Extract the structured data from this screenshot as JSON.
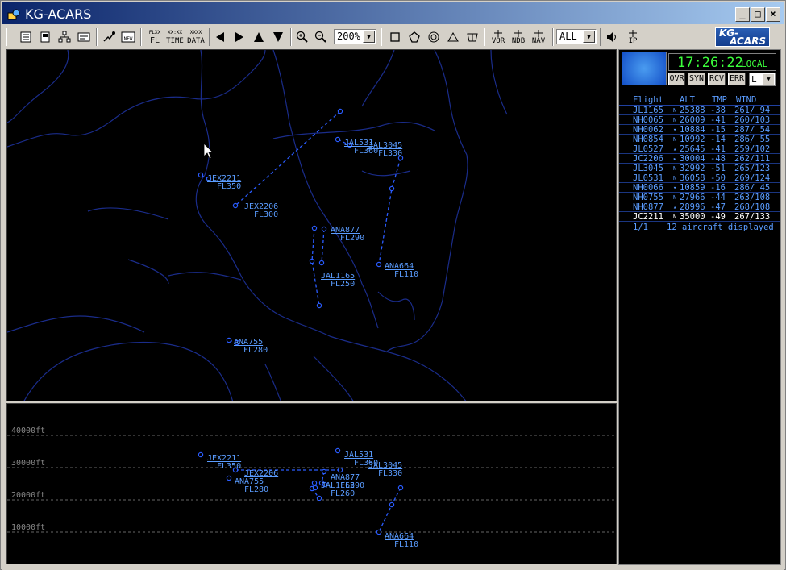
{
  "window": {
    "title": "KG-ACARS"
  },
  "titlebar": {
    "minimize": "_",
    "maximize": "□",
    "close": "×"
  },
  "toolbar": {
    "fl_label": "FL",
    "time_label": "TIME",
    "data_label": "DATA",
    "vor_label": "VOR",
    "ndb_label": "NDB",
    "nav_label": "NAV",
    "ip_label": "IP",
    "zoom_value": "200%",
    "filter_value": "ALL",
    "logo_line1": "KG-",
    "logo_line2": "ACARS"
  },
  "clock": {
    "time": "17:26:22",
    "zone": "LOCAL"
  },
  "flags": [
    "OVR",
    "SYN",
    "RCV",
    "ERR"
  ],
  "level_select": "L",
  "flight_list": {
    "headers": [
      "Flight",
      "ALT",
      "TMP",
      "WIND"
    ],
    "rows": [
      {
        "flight": "JL1165",
        "trend": "N",
        "alt": "25388",
        "tmp": "-38",
        "wind": "261/ 94",
        "selected": false
      },
      {
        "flight": "NH0065",
        "trend": "N",
        "alt": "26009",
        "tmp": "-41",
        "wind": "260/103",
        "selected": false
      },
      {
        "flight": "NH0062",
        "trend": "▾",
        "alt": "10884",
        "tmp": "-15",
        "wind": "287/ 54",
        "selected": false
      },
      {
        "flight": "NH0854",
        "trend": "N",
        "alt": "10992",
        "tmp": "-14",
        "wind": "286/ 55",
        "selected": false
      },
      {
        "flight": "JL0527",
        "trend": "▴",
        "alt": "25645",
        "tmp": "-41",
        "wind": "259/102",
        "selected": false
      },
      {
        "flight": "JC2206",
        "trend": "▸",
        "alt": "30004",
        "tmp": "-48",
        "wind": "262/111",
        "selected": false
      },
      {
        "flight": "JL3045",
        "trend": "N",
        "alt": "32992",
        "tmp": "-51",
        "wind": "265/123",
        "selected": false
      },
      {
        "flight": "JL0531",
        "trend": "N",
        "alt": "36058",
        "tmp": "-50",
        "wind": "269/124",
        "selected": false
      },
      {
        "flight": "NH0066",
        "trend": "▾",
        "alt": "10859",
        "tmp": "-16",
        "wind": "286/ 45",
        "selected": false
      },
      {
        "flight": "NH0755",
        "trend": "N",
        "alt": "27966",
        "tmp": "-44",
        "wind": "263/108",
        "selected": false
      },
      {
        "flight": "NH0877",
        "trend": "▴",
        "alt": "28996",
        "tmp": "-47",
        "wind": "268/108",
        "selected": false
      },
      {
        "flight": "JC2211",
        "trend": "N",
        "alt": "35000",
        "tmp": "-49",
        "wind": "267/133",
        "selected": true
      }
    ],
    "footer_page": "1/1",
    "footer_text": "12 aircraft displayed"
  },
  "map_labels": [
    {
      "callsign": "JEX2211",
      "level": "FL350"
    },
    {
      "callsign": "JEX2206",
      "level": "FL300"
    },
    {
      "callsign": "JAL531",
      "level": "FL360"
    },
    {
      "callsign": "JAL3045",
      "level": "FL330"
    },
    {
      "callsign": "ANA877",
      "level": "FL290"
    },
    {
      "callsign": "JAL1165",
      "level": "FL250"
    },
    {
      "callsign": "ANA664",
      "level": "FL110"
    },
    {
      "callsign": "ANA755",
      "level": "FL280"
    }
  ],
  "profile_axis": [
    "40000ft",
    "30000ft",
    "20000ft",
    "10000ft"
  ],
  "profile_labels": [
    {
      "callsign": "JEX2211",
      "level": "FL350"
    },
    {
      "callsign": "JAL531",
      "level": "FL360"
    },
    {
      "callsign": "JAL3045",
      "level": "FL330"
    },
    {
      "callsign": "JEX2206",
      "level": ""
    },
    {
      "callsign": "ANA755",
      "level": "FL280"
    },
    {
      "callsign": "ANA877",
      "level": "FL290"
    },
    {
      "callsign": "JAL1165",
      "level": "FL260"
    },
    {
      "callsign": "ANA664",
      "level": "FL110"
    }
  ],
  "colors": {
    "track": "#2a5cff",
    "label": "#5a9cff",
    "coast": "#1a2c8a",
    "clock": "#3cff3c"
  }
}
